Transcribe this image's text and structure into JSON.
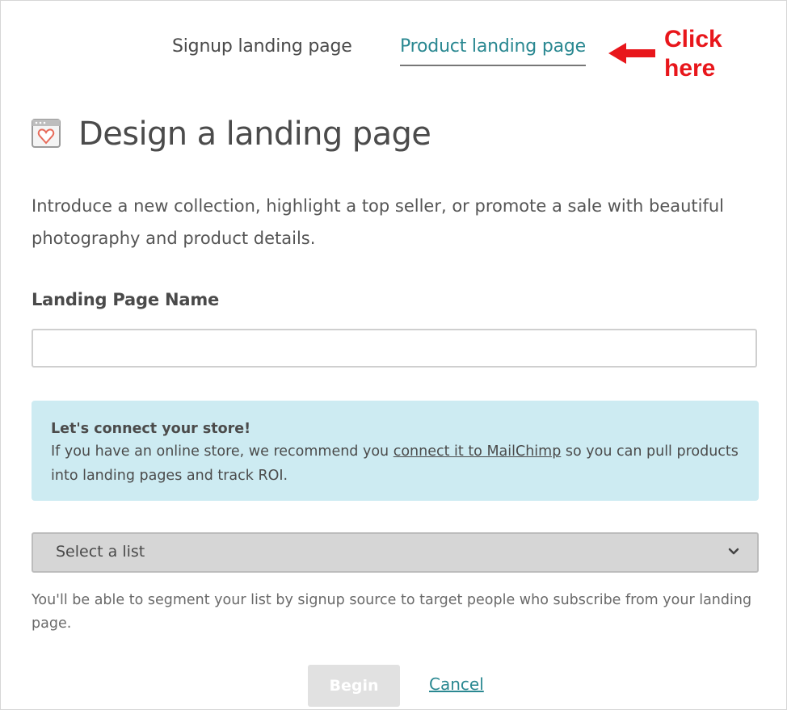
{
  "tabs": {
    "signup_label": "Signup landing page",
    "product_label": "Product landing page"
  },
  "annotation": {
    "text": "Click here",
    "color": "#e8161b"
  },
  "header": {
    "icon": "landing-page-heart-icon",
    "title": "Design a landing page"
  },
  "intro": "Introduce a new collection, highlight a top seller, or promote a sale with beautiful photography and product details.",
  "form": {
    "name_label": "Landing Page Name",
    "name_value": "",
    "name_placeholder": ""
  },
  "notice": {
    "title": "Let's connect your store!",
    "text_before": "If you have an online store, we recommend you ",
    "link": "connect it to MailChimp",
    "text_after": " so you can pull products into landing pages and track ROI.",
    "background": "#cdebf2"
  },
  "list_select": {
    "value": "Select a list",
    "icon": "chevron-down-icon"
  },
  "helper_text": "You'll be able to segment your list by signup source to target people who subscribe from your landing page.",
  "actions": {
    "begin_label": "Begin",
    "cancel_label": "Cancel"
  },
  "colors": {
    "accent": "#2a8891",
    "title": "#4b4b4b"
  }
}
